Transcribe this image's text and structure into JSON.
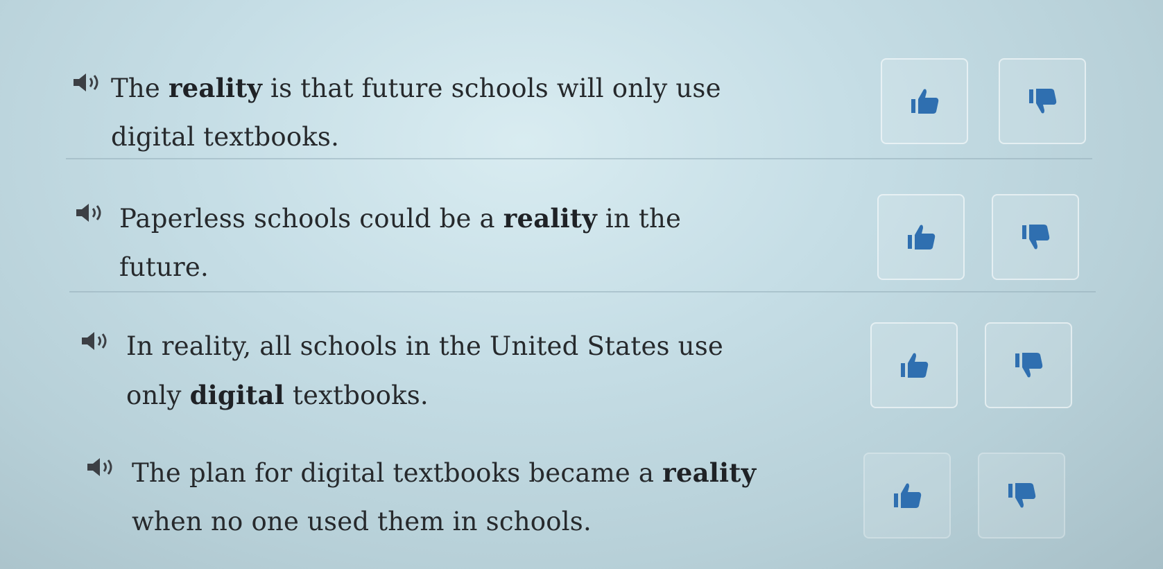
{
  "items": [
    {
      "parts": [
        {
          "text": "The ",
          "bold": false
        },
        {
          "text": "reality",
          "bold": true
        },
        {
          "text": " is that future schools will only use digital textbooks.",
          "bold": false
        }
      ],
      "audio_icon": "speaker-icon",
      "agree_icon": "thumbs-up-icon",
      "disagree_icon": "thumbs-down-icon"
    },
    {
      "parts": [
        {
          "text": "Paperless schools could be a ",
          "bold": false
        },
        {
          "text": "reality",
          "bold": true
        },
        {
          "text": " in the future.",
          "bold": false
        }
      ],
      "audio_icon": "speaker-icon",
      "agree_icon": "thumbs-up-icon",
      "disagree_icon": "thumbs-down-icon"
    },
    {
      "parts": [
        {
          "text": "In reality, all schools in the United States use only ",
          "bold": false
        },
        {
          "text": "digital",
          "bold": true
        },
        {
          "text": " textbooks.",
          "bold": false
        }
      ],
      "audio_icon": "speaker-icon",
      "agree_icon": "thumbs-up-icon",
      "disagree_icon": "thumbs-down-icon"
    },
    {
      "parts": [
        {
          "text": "The plan for digital textbooks became a ",
          "bold": false
        },
        {
          "text": "reality",
          "bold": true
        },
        {
          "text": " when no one used them in schools.",
          "bold": false
        }
      ],
      "audio_icon": "speaker-icon",
      "agree_icon": "thumbs-up-icon",
      "disagree_icon": "thumbs-down-icon"
    }
  ],
  "colors": {
    "thumb_icon": "#2f6fb0",
    "text": "#26292c",
    "speaker_icon": "#3c3f44"
  }
}
